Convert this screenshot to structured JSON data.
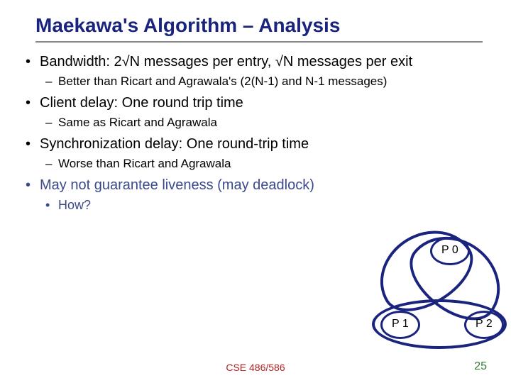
{
  "title": "Maekawa's Algorithm – Analysis",
  "bullets": {
    "b1": "Bandwidth: 2√N messages per entry, √N messages per exit",
    "b1a": "Better than Ricart and Agrawala's (2(N-1) and N-1 messages)",
    "b2": "Client delay: One round trip time",
    "b2a": "Same as Ricart and Agrawala",
    "b3": "Synchronization delay: One round-trip time",
    "b3a": "Worse than Ricart and Agrawala",
    "b4": "May not guarantee liveness (may deadlock)",
    "b4a": "How?"
  },
  "diagram": {
    "p0": "P 0",
    "p1": "P 1",
    "p2": "P 2"
  },
  "footer": {
    "center": "CSE 486/586",
    "page": "25"
  }
}
